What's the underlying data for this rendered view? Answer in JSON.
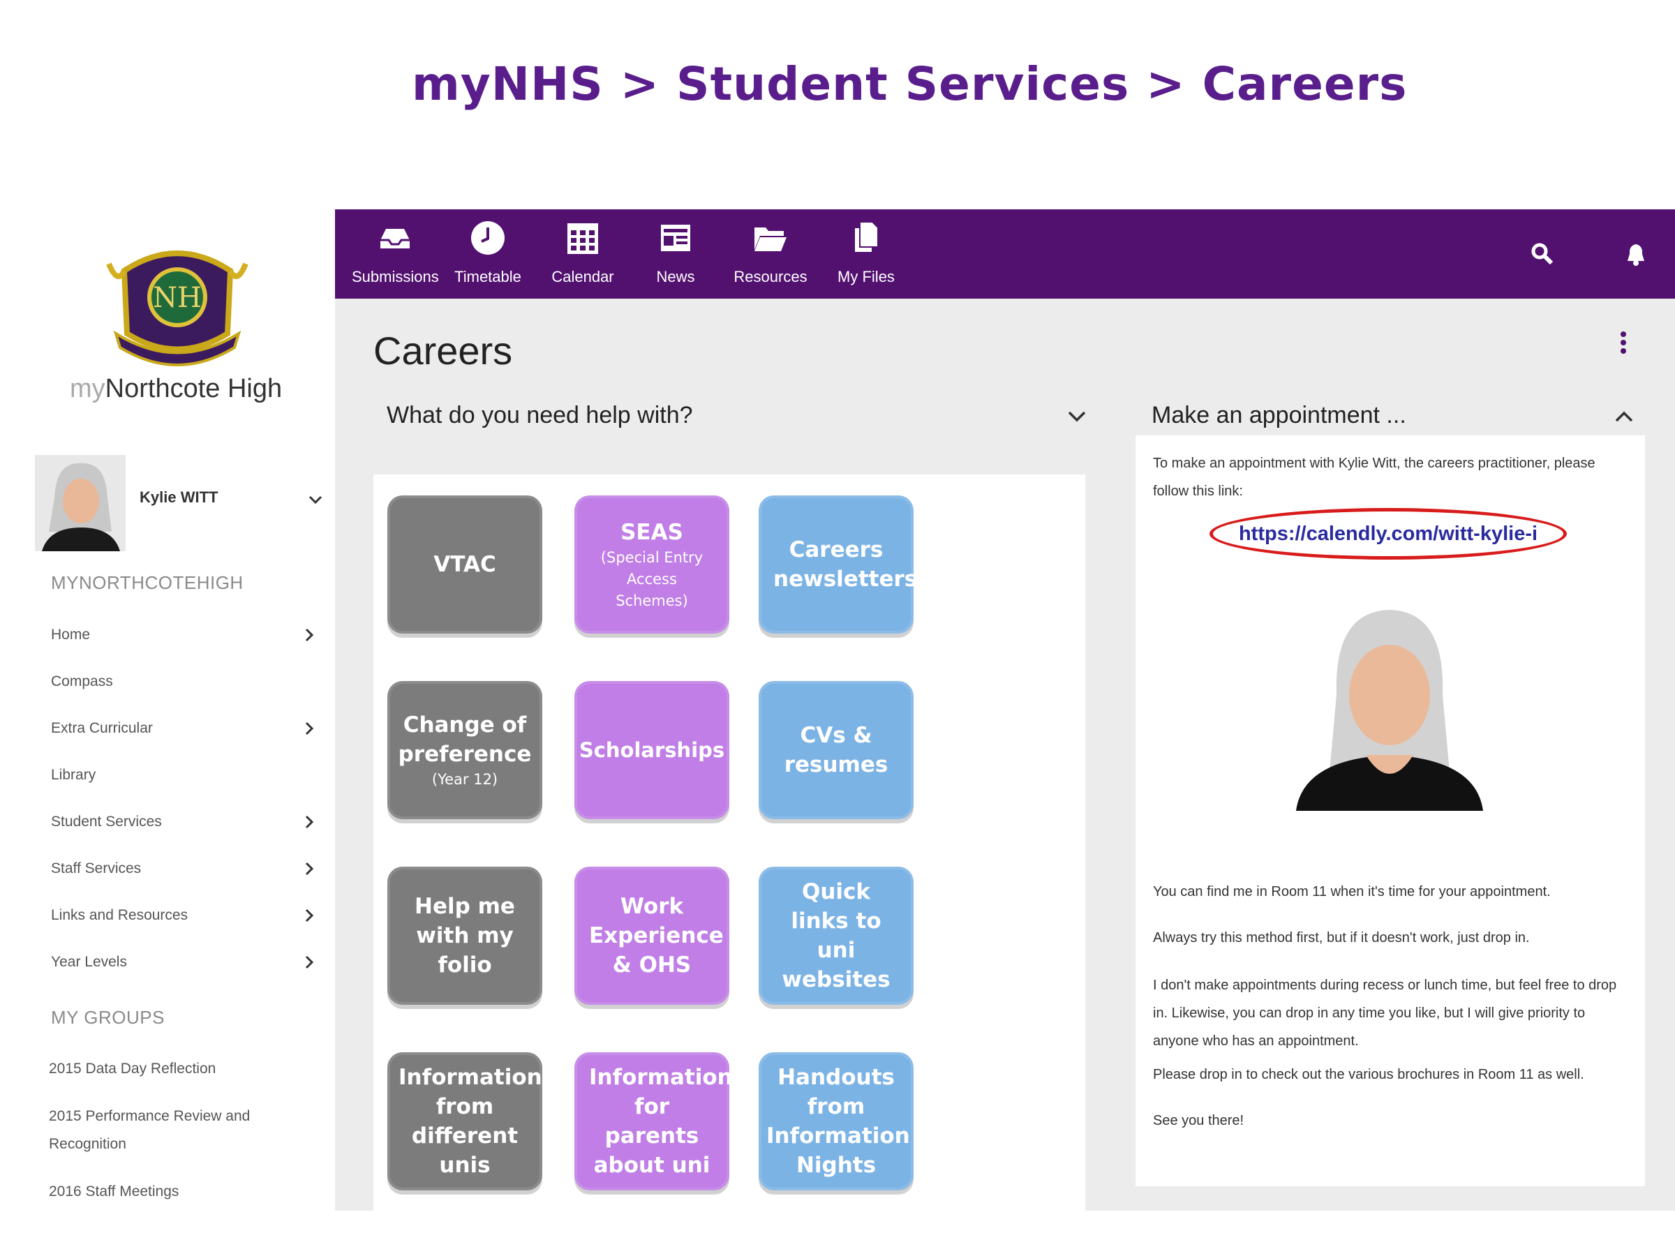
{
  "heading": "myNHS > Student Services > Careers",
  "sidebar": {
    "brand_my": "my",
    "brand_name": "Northcote High",
    "user_name": "Kylie WITT",
    "section_title": "MYNORTHCOTEHIGH",
    "nav_items": [
      {
        "label": "Home",
        "has_children": true
      },
      {
        "label": "Compass",
        "has_children": false
      },
      {
        "label": "Extra Curricular",
        "has_children": true
      },
      {
        "label": "Library",
        "has_children": false
      },
      {
        "label": "Student Services",
        "has_children": true
      },
      {
        "label": "Staff Services",
        "has_children": true
      },
      {
        "label": "Links and Resources",
        "has_children": true
      },
      {
        "label": "Year Levels",
        "has_children": true
      }
    ],
    "groups_title": "MY GROUPS",
    "groups": [
      "2015 Data Day Reflection",
      "2015 Performance Review and Recognition",
      "2016 Staff Meetings"
    ]
  },
  "topbar": {
    "items": [
      {
        "label": "Submissions",
        "icon": "inbox-tray-icon"
      },
      {
        "label": "Timetable",
        "icon": "clock-icon"
      },
      {
        "label": "Calendar",
        "icon": "calendar-grid-icon"
      },
      {
        "label": "News",
        "icon": "newspaper-icon"
      },
      {
        "label": "Resources",
        "icon": "folder-open-icon"
      },
      {
        "label": "My Files",
        "icon": "documents-icon"
      }
    ],
    "right_icons": [
      "search-icon",
      "bell-icon"
    ],
    "color": "#52116f"
  },
  "main": {
    "title": "Careers",
    "help_panel_title": "What do you need help with?",
    "appt_panel_title": "Make an appointment ...",
    "tiles": [
      {
        "title": "VTAC",
        "sub": "",
        "color": "grey"
      },
      {
        "title": "SEAS",
        "sub": "(Special Entry Access Schemes)",
        "color": "purple"
      },
      {
        "title": "Careers newsletters",
        "sub": "",
        "color": "blue"
      },
      {
        "title": "Change of preference",
        "sub": "(Year 12)",
        "color": "grey"
      },
      {
        "title": "Scholarships",
        "sub": "",
        "color": "purple"
      },
      {
        "title": "CVs & resumes",
        "sub": "",
        "color": "blue"
      },
      {
        "title": "Help me with my folio",
        "sub": "",
        "color": "grey"
      },
      {
        "title": "Work Experience & OHS",
        "sub": "",
        "color": "purple"
      },
      {
        "title": "Quick links to uni websites",
        "sub": "",
        "color": "blue"
      },
      {
        "title": "Information from different unis",
        "sub": "",
        "color": "grey"
      },
      {
        "title": "Information for parents about uni",
        "sub": "",
        "color": "purple"
      },
      {
        "title": "Handouts from Information Nights",
        "sub": "",
        "color": "blue"
      }
    ],
    "appointment": {
      "intro": "To make an appointment with Kylie Witt, the careers practitioner, please follow this link:",
      "link": "https://calendly.com/witt-kylie-i",
      "para1": "You can find me in Room 11 when it's time for your appointment.",
      "para2": "Always try this method first, but if it doesn't work, just drop in.",
      "para3": "I don't make appointments during recess or lunch time, but feel free to drop in. Likewise, you can drop in any time you like, but I will give priority to anyone who has an appointment.",
      "para4": "Please drop in to check out the various brochures in Room 11 as well.",
      "para5": "See you there!"
    }
  },
  "colors": {
    "tile_grey": "#7c7c7c",
    "tile_purple": "#c07ee6",
    "tile_blue": "#7cb3e5",
    "heading": "#5a1e8c",
    "link_oval": "#d81b1b"
  }
}
